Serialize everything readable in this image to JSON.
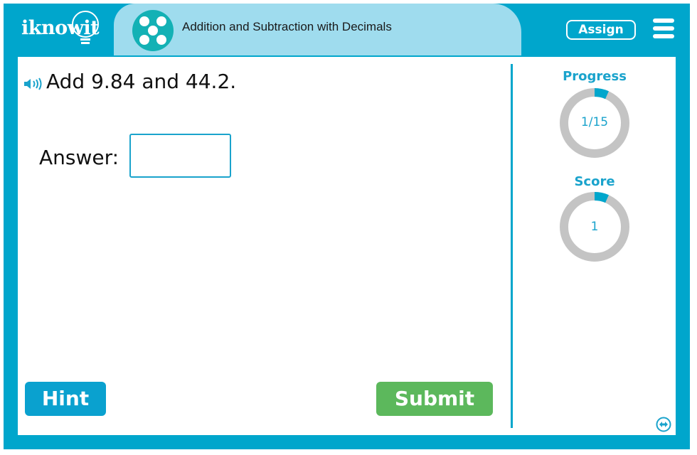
{
  "header": {
    "logo_text": "iknowit",
    "topic_icon": "dice-five-icon",
    "topic_title": "Addition and Subtraction with Decimals",
    "assign_label": "Assign",
    "menu_icon": "hamburger-menu-icon"
  },
  "question": {
    "speaker_icon": "speaker-icon",
    "text": "Add 9.84 and 44.2.",
    "answer_label": "Answer:",
    "answer_value": "",
    "answer_placeholder": ""
  },
  "buttons": {
    "hint_label": "Hint",
    "submit_label": "Submit"
  },
  "sidebar": {
    "progress": {
      "label": "Progress",
      "text": "1/15",
      "current": 1,
      "total": 15
    },
    "score": {
      "label": "Score",
      "text": "1",
      "fraction": 0.0667
    },
    "expand_icon": "expand-horizontal-icon"
  },
  "colors": {
    "brand": "#00a6cc",
    "title_bg": "#9fdcee",
    "topic_icon": "#13b1b5",
    "ring_track": "#c4c4c4",
    "ring_fill": "#00a6cc",
    "submit": "#5cb85c",
    "hint": "#0aa1cf"
  }
}
